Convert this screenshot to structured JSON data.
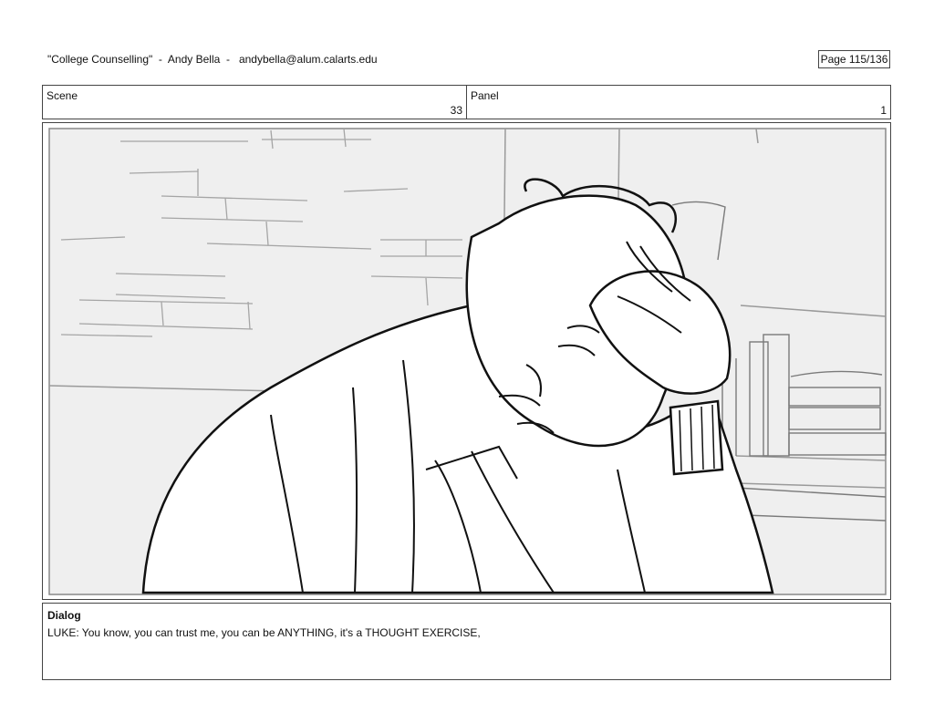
{
  "header": {
    "title": "\"College Counselling\"  -  Andy Bella  -   andybella@alum.calarts.edu",
    "page": "Page 115/136"
  },
  "scene": {
    "label": "Scene",
    "value": "33"
  },
  "panel": {
    "label": "Panel",
    "value": "1"
  },
  "image": {
    "icon": "storyboard-sketch",
    "subject": "LUKE"
  },
  "dialog": {
    "label": "Dialog",
    "text": "LUKE: You know, you can trust me, you can be ANYTHING, it's a THOUGHT EXERCISE,"
  }
}
